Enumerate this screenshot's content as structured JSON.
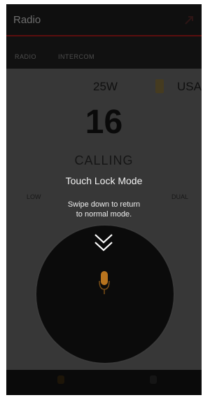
{
  "app": {
    "title": "Radio",
    "tabs": [
      "RADIO",
      "INTERCOM"
    ]
  },
  "radio": {
    "power": "25W",
    "region": "USA",
    "channel": "16",
    "status": "CALLING",
    "side_left": "LOW",
    "side_right": "DUAL"
  },
  "lock": {
    "title": "Touch Lock Mode",
    "desc_line1": "Swipe down to return",
    "desc_line2": "to normal mode."
  },
  "colors": {
    "accent": "#b71c1c",
    "mic": "#b8741e",
    "content_bg": "#6f6f6f"
  },
  "icons": {
    "action": "overflow-icon",
    "swipe": "double-chevron-down-icon",
    "ptt": "microphone-icon"
  }
}
